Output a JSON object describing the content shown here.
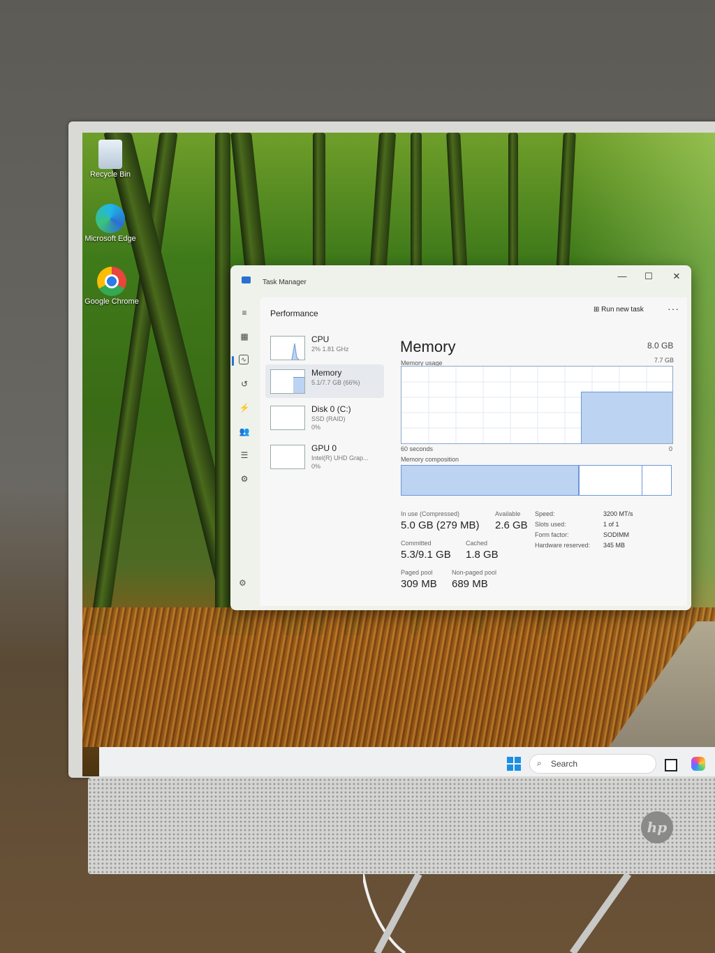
{
  "desktop": {
    "icons": [
      {
        "label": "Recycle Bin",
        "icon": "recycle-bin-icon"
      },
      {
        "label": "Microsoft Edge",
        "icon": "edge-icon"
      },
      {
        "label": "Google Chrome",
        "icon": "chrome-icon"
      }
    ]
  },
  "taskbar": {
    "search_placeholder": "Search"
  },
  "task_manager": {
    "title": "Task Manager",
    "window_controls": {
      "minimize": "—",
      "maximize": "☐",
      "close": "✕"
    },
    "header": {
      "section_title": "Performance",
      "run_new_task": "Run new task",
      "more": "···"
    },
    "devices": [
      {
        "name": "CPU",
        "sub1": "2% 1.81 GHz",
        "sub2": ""
      },
      {
        "name": "Memory",
        "sub1": "5.1/7.7 GB (66%)",
        "sub2": ""
      },
      {
        "name": "Disk 0 (C:)",
        "sub1": "SSD (RAID)",
        "sub2": "0%"
      },
      {
        "name": "GPU 0",
        "sub1": "Intel(R) UHD Grap...",
        "sub2": "0%"
      }
    ],
    "memory": {
      "title": "Memory",
      "total": "8.0 GB",
      "usage_label": "Memory usage",
      "usage_max": "7.7 GB",
      "usage_fraction": 0.66,
      "time_label": "60 seconds",
      "time_end": "0",
      "composition_label": "Memory composition",
      "composition_in_use_fraction": 0.655,
      "composition_cached_end_fraction": 0.89,
      "stats": {
        "in_use_label": "In use (Compressed)",
        "in_use_value": "5.0 GB (279 MB)",
        "available_label": "Available",
        "available_value": "2.6 GB",
        "committed_label": "Committed",
        "committed_value": "5.3/9.1 GB",
        "cached_label": "Cached",
        "cached_value": "1.8 GB",
        "paged_label": "Paged pool",
        "paged_value": "309 MB",
        "nonpaged_label": "Non-paged pool",
        "nonpaged_value": "689 MB"
      },
      "specs": [
        {
          "label": "Speed:",
          "value": "3200 MT/s"
        },
        {
          "label": "Slots used:",
          "value": "1 of 1"
        },
        {
          "label": "Form factor:",
          "value": "SODIMM"
        },
        {
          "label": "Hardware reserved:",
          "value": "345 MB"
        }
      ]
    }
  },
  "colors": {
    "accent": "#2b6fd0",
    "memory_fill": "#bcd3f2",
    "memory_line": "#6c97d6"
  }
}
